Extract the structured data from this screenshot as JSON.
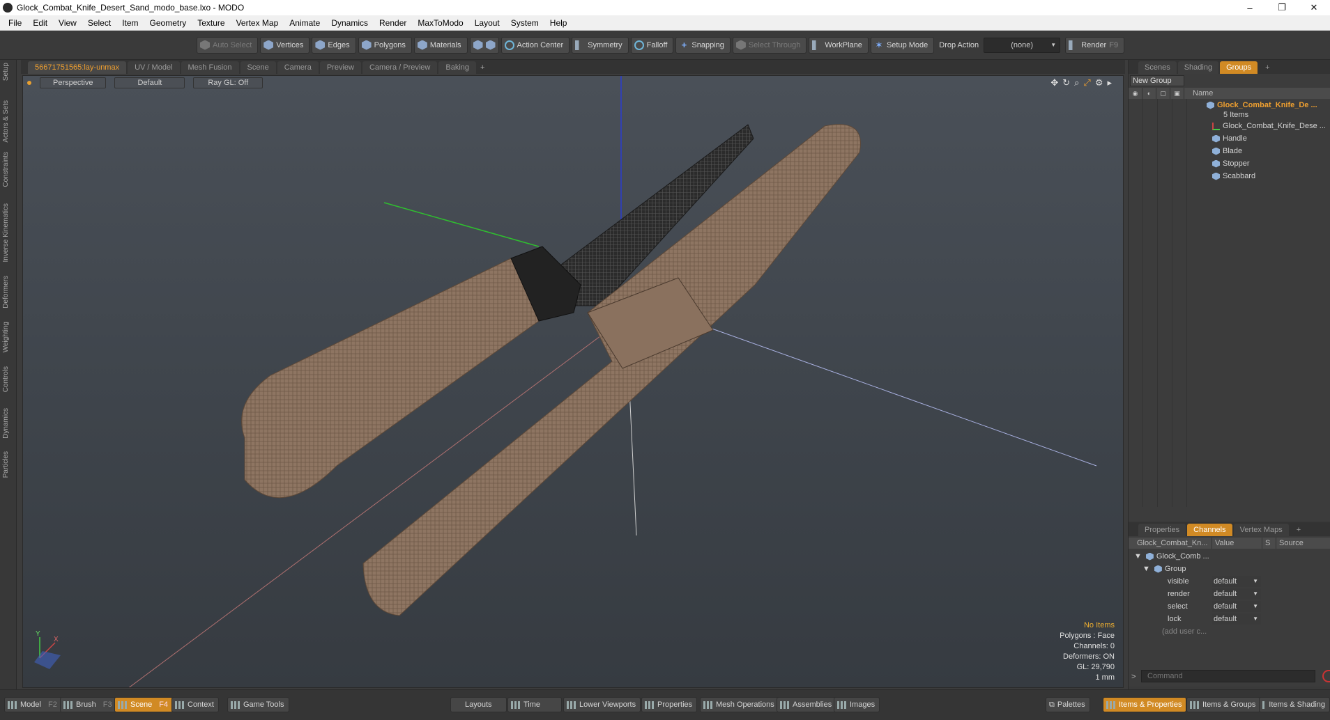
{
  "window": {
    "title": "Glock_Combat_Knife_Desert_Sand_modo_base.lxo - MODO",
    "minimize": "–",
    "restore": "❐",
    "close": "✕"
  },
  "menu": [
    "File",
    "Edit",
    "View",
    "Select",
    "Item",
    "Geometry",
    "Texture",
    "Vertex Map",
    "Animate",
    "Dynamics",
    "Render",
    "MaxToModo",
    "Layout",
    "System",
    "Help"
  ],
  "toolbar": {
    "auto_select": "Auto Select",
    "vertices": "Vertices",
    "edges": "Edges",
    "polygons": "Polygons",
    "materials": "Materials",
    "action_center": "Action Center",
    "symmetry": "Symmetry",
    "falloff": "Falloff",
    "snapping": "Snapping",
    "select_through": "Select Through",
    "workplane": "WorkPlane",
    "setup_mode": "Setup Mode",
    "drop_action": "Drop Action",
    "drop_value": "(none)",
    "render": "Render",
    "render_key": "F9"
  },
  "left_tabs": [
    "Setup",
    "Actors & Sets",
    "Constraints",
    "Inverse Kinematics",
    "Deformers",
    "Weighting",
    "Controls",
    "Dynamics",
    "Particles"
  ],
  "viewport_tabs": [
    "56671751565:lay-unmax",
    "UV / Model",
    "Mesh Fusion",
    "Scene",
    "Camera",
    "Preview",
    "Camera / Preview",
    "Baking",
    "+"
  ],
  "viewport": {
    "view": "Perspective",
    "style": "Default",
    "raygl": "Ray GL: Off",
    "info": {
      "items": "No Items",
      "polygons": "Polygons : Face",
      "channels": "Channels: 0",
      "deformers": "Deformers: ON",
      "gl": "GL: 29,790",
      "unit": "1 mm"
    },
    "axis_x": "X",
    "axis_y": "Y"
  },
  "scene_panel": {
    "tabs": [
      "Scenes",
      "Shading",
      "Groups",
      "+"
    ],
    "new_group": "New Group",
    "name_col": "Name",
    "root": "Glock_Combat_Knife_De ...",
    "root_count": "5 Items",
    "children": [
      "Glock_Combat_Knife_Dese ...",
      "Handle",
      "Blade",
      "Stopper",
      "Scabbard"
    ]
  },
  "channels_panel": {
    "tabs": [
      "Properties",
      "Channels",
      "Vertex Maps",
      "+"
    ],
    "headers": [
      "Glock_Combat_Kn...",
      "Value",
      "S",
      "Source"
    ],
    "root": "Glock_Comb ...",
    "group": "Group",
    "rows": [
      {
        "name": "visible",
        "value": "default"
      },
      {
        "name": "render",
        "value": "default"
      },
      {
        "name": "select",
        "value": "default"
      },
      {
        "name": "lock",
        "value": "default"
      }
    ],
    "add_user": "(add user c...",
    "command_placeholder": "Command"
  },
  "bottom": {
    "model": "Model",
    "model_key": "F2",
    "brush": "Brush",
    "brush_key": "F3",
    "scene": "Scene",
    "scene_key": "F4",
    "context": "Context",
    "game_tools": "Game Tools",
    "layouts": "Layouts",
    "time": "Time",
    "lower_viewports": "Lower Viewports",
    "properties": "Properties",
    "mesh_operations": "Mesh Operations",
    "assemblies": "Assemblies",
    "images": "Images",
    "palettes": "Palettes",
    "items_properties": "Items & Properties",
    "items_groups": "Items & Groups",
    "items_shading": "Items & Shading"
  },
  "colors": {
    "accent": "#d18a24",
    "knife_sand": "#8a7260",
    "blade_dark": "#2a2a2a"
  }
}
